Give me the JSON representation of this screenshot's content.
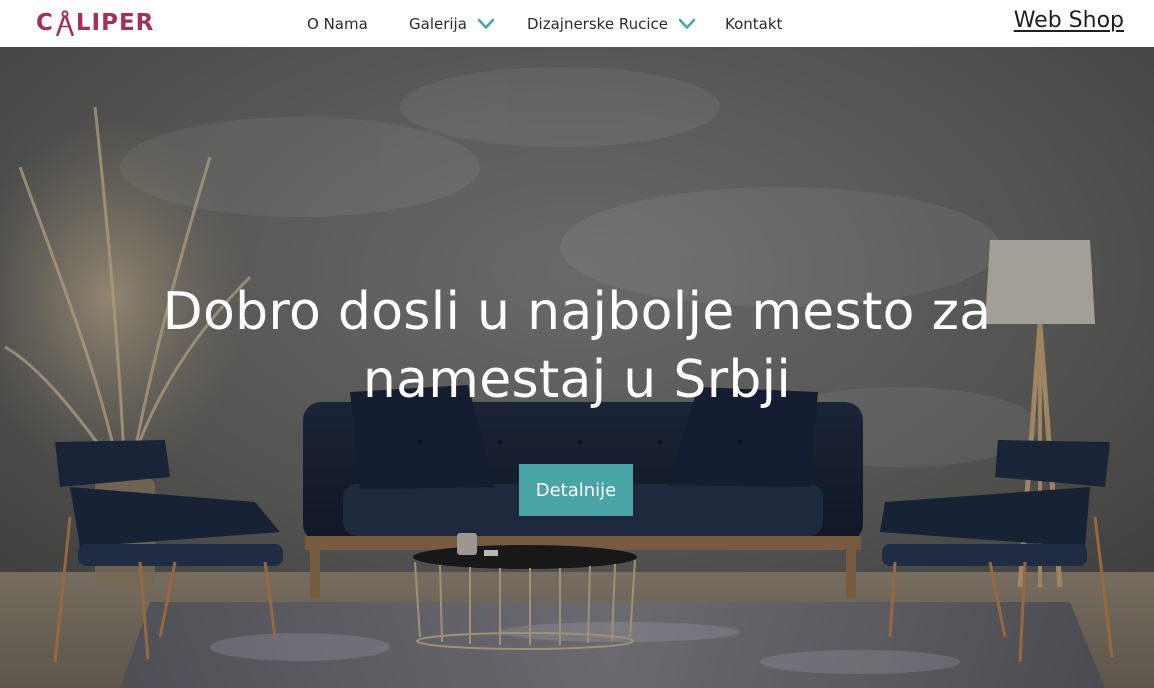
{
  "brand": {
    "logo_text_left": "C",
    "logo_text_right": "LIPER",
    "color": "#a2305f"
  },
  "nav": {
    "items": [
      {
        "label": "O Nama",
        "has_dropdown": false
      },
      {
        "label": "Galerija",
        "has_dropdown": true
      },
      {
        "label": "Dizajnerske Rucice",
        "has_dropdown": true
      },
      {
        "label": "Kontakt",
        "has_dropdown": false
      }
    ],
    "chevron_icon": "chevron-down-icon",
    "chevron_color": "#4aa3a4",
    "web_shop_label": "Web Shop"
  },
  "hero": {
    "title_line1": "Dobro dosli u najbolje mesto za",
    "title_line2": "namestaj u Srbji",
    "cta_label": "Detalnije",
    "cta_color": "#4aa3a4"
  }
}
